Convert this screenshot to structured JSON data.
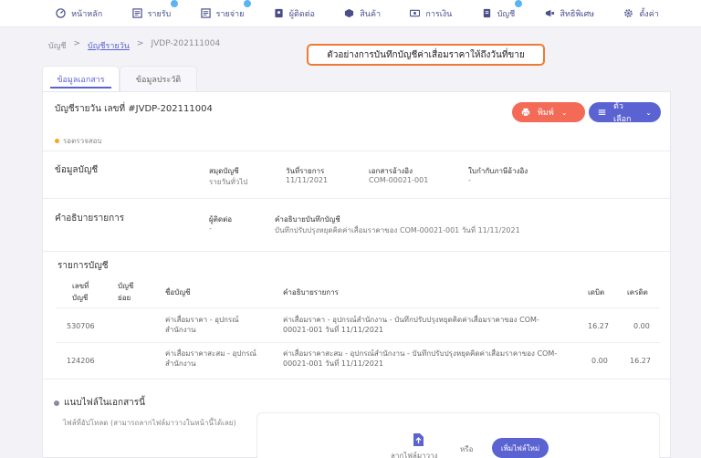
{
  "nav": {
    "items": [
      {
        "label": "หน้าหลัก",
        "icon": "dashboard-icon",
        "badge": false
      },
      {
        "label": "รายรับ",
        "icon": "income-icon",
        "badge": true
      },
      {
        "label": "รายจ่าย",
        "icon": "expense-icon",
        "badge": true
      },
      {
        "label": "ผู้ติดต่อ",
        "icon": "contacts-icon",
        "badge": false
      },
      {
        "label": "สินค้า",
        "icon": "box-icon",
        "badge": false
      },
      {
        "label": "การเงิน",
        "icon": "money-icon",
        "badge": false
      },
      {
        "label": "บัญชี",
        "icon": "ledger-icon",
        "badge": true
      },
      {
        "label": "สิทธิพิเศษ",
        "icon": "megaphone-icon",
        "badge": false
      },
      {
        "label": "ตั้งค่า",
        "icon": "gear-icon",
        "badge": false
      }
    ]
  },
  "breadcrumb": {
    "root": "บัญชี",
    "link": "บัญชีรายวัน",
    "current": "JVDP-202111004"
  },
  "callout": "ตัวอย่างการบันทึกบัญชีค่าเสื่อมราคาให้ถึงวันที่ขาย",
  "tabs": {
    "document": "ข้อมูลเอกสาร",
    "history": "ข้อมูลประวัติ"
  },
  "doc": {
    "title": "บัญชีรายวัน เลขที่ #JVDP-202111004",
    "status": "รอตรวจสอบ",
    "print_label": "พิมพ์",
    "options_label": "ตัวเลือก"
  },
  "account_info": {
    "section": "ข้อมูลบัญชี",
    "book_label": "สมุดบัญชี",
    "book_value": "รายวันทั่วไป",
    "date_label": "วันที่รายการ",
    "date_value": "11/11/2021",
    "ref_label": "เอกสารอ้างอิง",
    "ref_value": "COM-00021-001",
    "tax_label": "ใบกำกับภาษีอ้างอิง",
    "tax_value": "-"
  },
  "description": {
    "section": "คำอธิบายรายการ",
    "contact_label": "ผู้ติดต่อ",
    "contact_value": "-",
    "note_label": "คำอธิบายบันทึกบัญชี",
    "note_value": "บันทึกปรับปรุงหยุดคิดค่าเสื่อมราคาของ COM-00021-001 วันที่ 11/11/2021"
  },
  "entries": {
    "section": "รายการบัญชี",
    "headers": {
      "account_no": "เลขที่\nบัญชี",
      "sub_account": "บัญชี\nย่อย",
      "account_name": "ชื่อบัญชี",
      "description": "คำอธิบายรายการ",
      "debit": "เดบิต",
      "credit": "เครดิต"
    },
    "rows": [
      {
        "account_no": "530706",
        "sub_account": "",
        "account_name": "ค่าเสื่อมราคา - อุปกรณ์\nสำนักงาน",
        "description": "ค่าเสื่อมราคา - อุปกรณ์สำนักงาน - บันทึกปรับปรุงหยุดคิดค่าเสื่อมราคาของ COM-\n00021-001 วันที่ 11/11/2021",
        "debit": "16.27",
        "credit": "0.00"
      },
      {
        "account_no": "124206",
        "sub_account": "",
        "account_name": "ค่าเสื่อมราคาสะสม - อุปกรณ์\nสำนักงาน",
        "description": "ค่าเสื่อมราคาสะสม - อุปกรณ์สำนักงาน - บันทึกปรับปรุงหยุดคิดค่าเสื่อมราคาของ COM-\n00021-001 วันที่ 11/11/2021",
        "debit": "0.00",
        "credit": "16.27"
      }
    ]
  },
  "attachments": {
    "section": "แนบไฟล์ในเอกสารนี้",
    "hint": "ไฟล์ที่อัปโหลด (สามารถลากไฟล์มาวางในหน้านี้ได้เลย)",
    "drop_label": "ลากไฟล์มาวาง",
    "or_label": "หรือ",
    "add_label": "เพิ่มไฟล์ใหม่"
  },
  "colors": {
    "accent": "#5b63d3",
    "print": "#f36b56",
    "callout_border": "#ee7a35",
    "status_dot": "#f5a623"
  }
}
